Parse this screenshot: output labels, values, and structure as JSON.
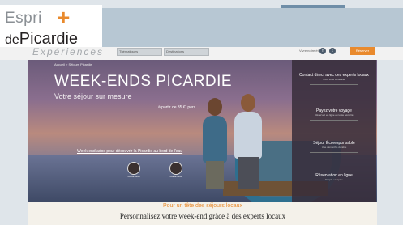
{
  "brand": {
    "name_line1": "Espri",
    "name_line2_prefix": "de",
    "name_line2": "Picardie",
    "tagline": "Expériences",
    "accent_color": "#e98a2d"
  },
  "nav": {
    "select_1": "Thématiques",
    "select_2": "Destinations",
    "link": "Vivre notre été",
    "social_1": "f",
    "social_2": "t",
    "cta_label": "Réserver"
  },
  "hero": {
    "breadcrumb": "Accueil > Séjours Picardie",
    "title": "WEEK-ENDS PICARDIE",
    "subtitle": "Votre séjour sur mesure",
    "price": "à partir de 35 €/ pers.",
    "link": "Week-end ados pour découvrir la Picardie au bord de l'eau",
    "guides": [
      {
        "name": "Guide local"
      },
      {
        "name": "Guide local"
      }
    ]
  },
  "sidebar": {
    "items": [
      {
        "title": "Contact direct avec des experts locaux",
        "desc": "Pour vous conseiller"
      },
      {
        "title": "Payez votre voyage",
        "desc": "Réservez en ligne en toute sécurité"
      },
      {
        "title": "Séjour Écoresponsable",
        "desc": "Une démarche durable"
      },
      {
        "title": "Réservation en ligne",
        "desc": "Simple et rapide"
      }
    ]
  },
  "footer": {
    "orange_line": "Pour un tête des séjours locaux",
    "main_line": "Personnalisez votre week-end grâce à des experts locaux"
  }
}
